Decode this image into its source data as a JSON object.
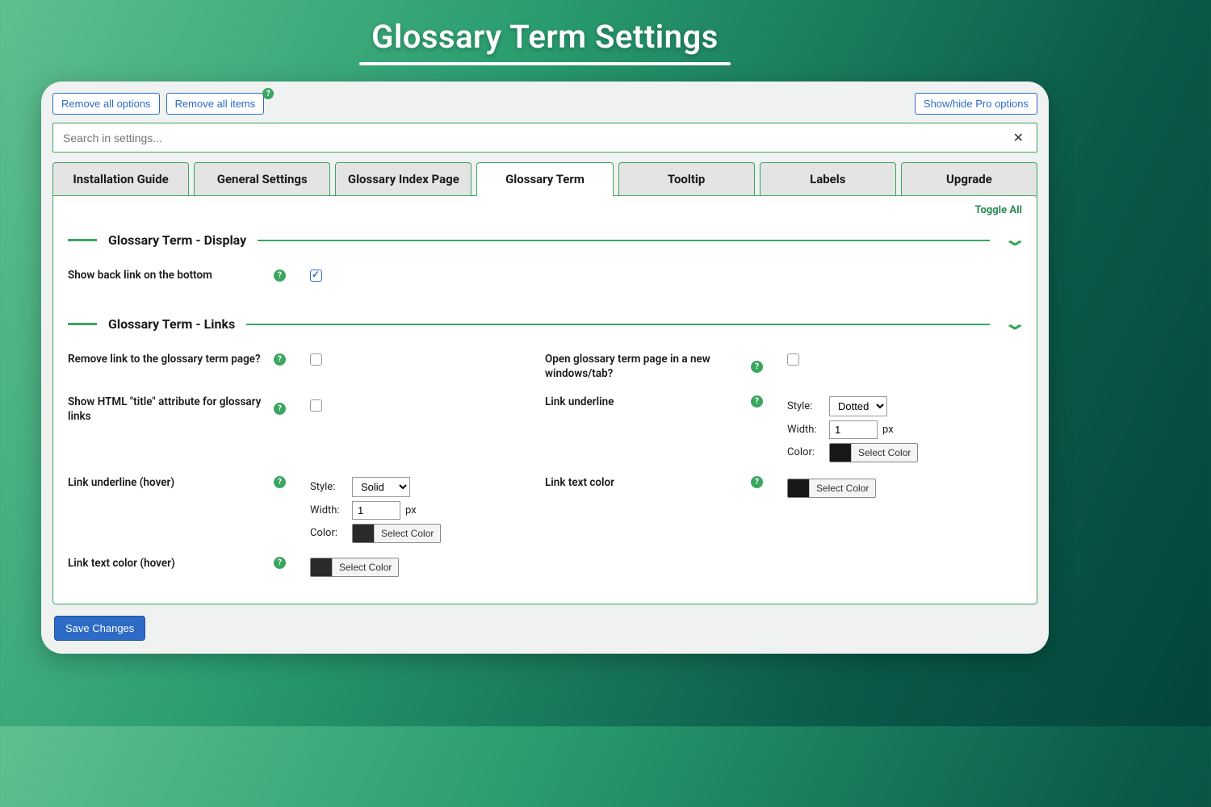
{
  "hero": {
    "title": "Glossary Term Settings"
  },
  "topbar": {
    "remove_options": "Remove all options",
    "remove_items": "Remove all items",
    "pro_toggle": "Show/hide Pro options"
  },
  "search": {
    "placeholder": "Search in settings..."
  },
  "tabs": [
    {
      "label": "Installation Guide"
    },
    {
      "label": "General Settings"
    },
    {
      "label": "Glossary Index Page"
    },
    {
      "label": "Glossary Term"
    },
    {
      "label": "Tooltip"
    },
    {
      "label": "Labels"
    },
    {
      "label": "Upgrade"
    }
  ],
  "toggle_all": "Toggle All",
  "sections": {
    "display": {
      "title": "Glossary Term - Display",
      "rows": {
        "back_link": {
          "label": "Show back link on the bottom",
          "checked": true
        }
      }
    },
    "links": {
      "title": "Glossary Term - Links",
      "rows": {
        "remove_link": {
          "label": "Remove link to the glossary term page?",
          "checked": false
        },
        "open_new": {
          "label": "Open glossary term page in a new windows/tab?",
          "checked": false
        },
        "show_title": {
          "label": "Show HTML \"title\" attribute for glossary links",
          "checked": false
        },
        "underline": {
          "label": "Link underline",
          "style_label": "Style:",
          "style_value": "Dotted",
          "width_label": "Width:",
          "width_value": "1",
          "width_unit": "px",
          "color_label": "Color:",
          "color_btn": "Select Color"
        },
        "underline_hover": {
          "label": "Link underline (hover)",
          "style_label": "Style:",
          "style_value": "Solid",
          "width_label": "Width:",
          "width_value": "1",
          "width_unit": "px",
          "color_label": "Color:",
          "color_btn": "Select Color"
        },
        "text_color": {
          "label": "Link text color",
          "color_btn": "Select Color"
        },
        "text_color_hover": {
          "label": "Link text color (hover)",
          "color_btn": "Select Color"
        }
      }
    }
  },
  "save": "Save Changes"
}
